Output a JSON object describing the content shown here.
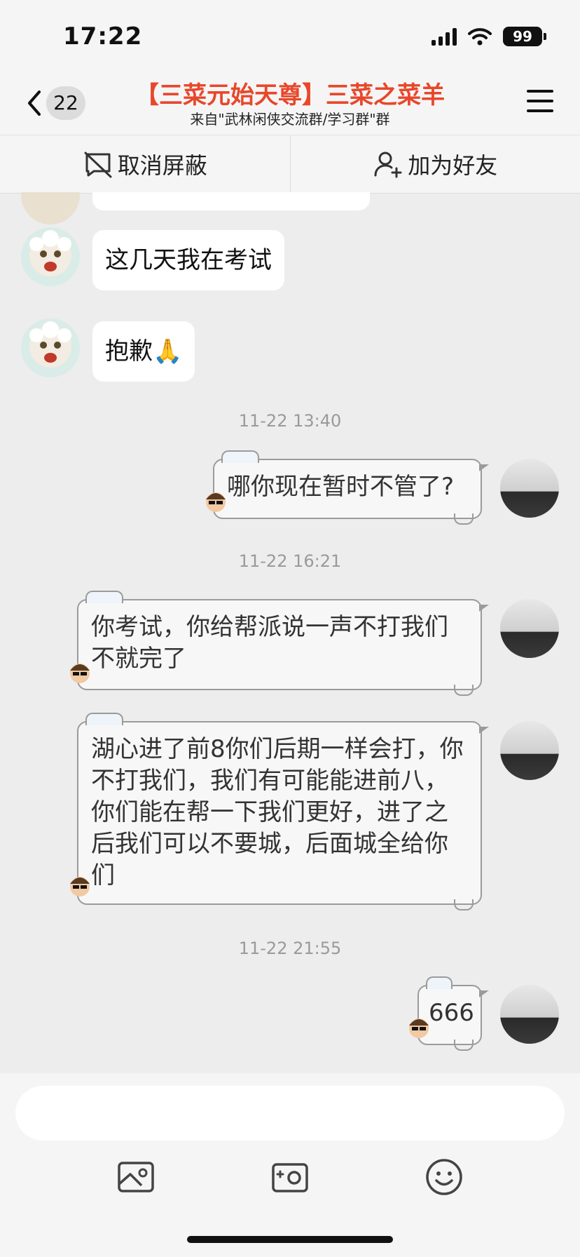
{
  "status_bar": {
    "time": "17:22",
    "battery": "99"
  },
  "header": {
    "unread_count": "22",
    "title": "【三菜元始天尊】三菜之菜羊",
    "subtitle": "来自\"武林闲侠交流群/学习群\"群"
  },
  "actions": {
    "unblock": "取消屏蔽",
    "add_friend": "加为好友"
  },
  "messages": [
    {
      "side": "left",
      "text": "这几天我在考试"
    },
    {
      "side": "left",
      "text": "抱歉🙏"
    },
    {
      "type": "time",
      "text": "11-22 13:40"
    },
    {
      "side": "right",
      "text": "哪你现在暂时不管了?"
    },
    {
      "type": "time",
      "text": "11-22 16:21"
    },
    {
      "side": "right",
      "text": "你考试，你给帮派说一声不打我们不就完了"
    },
    {
      "side": "right",
      "text": "湖心进了前8你们后期一样会打，你不打我们，我们有可能能进前八，你们能在帮一下我们更好，进了之后我们可以不要城，后面城全给你们"
    },
    {
      "type": "time",
      "text": "11-22 21:55"
    },
    {
      "side": "right",
      "text": "666"
    }
  ],
  "input": {
    "placeholder": ""
  },
  "toolbar": {
    "icons": [
      "image-icon",
      "camera-icon",
      "emoji-icon"
    ]
  }
}
